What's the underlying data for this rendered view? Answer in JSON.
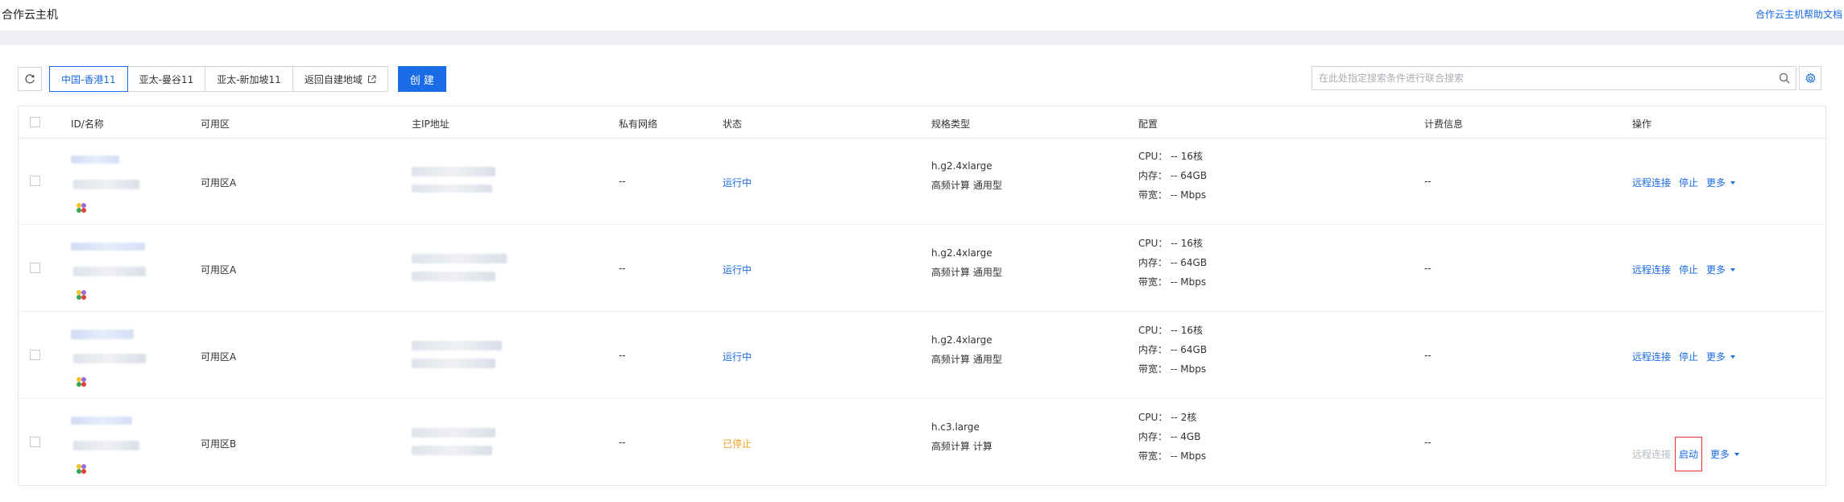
{
  "header": {
    "title": "合作云主机",
    "help_link": "合作云主机帮助文档"
  },
  "toolbar": {
    "regions": [
      {
        "label": "中国-香港11",
        "active": true
      },
      {
        "label": "亚太-曼谷11",
        "active": false
      },
      {
        "label": "亚太-新加坡11",
        "active": false
      },
      {
        "label": "返回自建地域",
        "active": false
      }
    ],
    "create_label": "创 建"
  },
  "search": {
    "placeholder": "在此处指定搜索条件进行联合搜索"
  },
  "table": {
    "columns": [
      "ID/名称",
      "可用区",
      "主IP地址",
      "私有网络",
      "状态",
      "规格类型",
      "配置",
      "计费信息",
      "操作"
    ],
    "rows": [
      {
        "zone": "可用区A",
        "vpc": "--",
        "status": "运行中",
        "status_type": "running",
        "spec_name": "h.g2.4xlarge",
        "spec_family": "高频计算 通用型",
        "cpu": "CPU：  -- 16核",
        "mem": "内存：  -- 64GB",
        "bw": "带宽：  -- Mbps",
        "billing": "--",
        "ops": {
          "remote": "远程连接",
          "action": "停止",
          "more": "更多"
        }
      },
      {
        "zone": "可用区A",
        "vpc": "--",
        "status": "运行中",
        "status_type": "running",
        "spec_name": "h.g2.4xlarge",
        "spec_family": "高频计算 通用型",
        "cpu": "CPU：  -- 16核",
        "mem": "内存：  -- 64GB",
        "bw": "带宽：  -- Mbps",
        "billing": "--",
        "ops": {
          "remote": "远程连接",
          "action": "停止",
          "more": "更多"
        }
      },
      {
        "zone": "可用区A",
        "vpc": "--",
        "status": "运行中",
        "status_type": "running",
        "spec_name": "h.g2.4xlarge",
        "spec_family": "高频计算 通用型",
        "cpu": "CPU：  -- 16核",
        "mem": "内存：  -- 64GB",
        "bw": "带宽：  -- Mbps",
        "billing": "--",
        "ops": {
          "remote": "远程连接",
          "action": "停止",
          "more": "更多"
        }
      },
      {
        "zone": "可用区B",
        "vpc": "--",
        "status": "已停止",
        "status_type": "stopped",
        "spec_name": "h.c3.large",
        "spec_family": "高频计算 计算",
        "cpu": "CPU：  -- 2核",
        "mem": "内存：  -- 4GB",
        "bw": "带宽：  -- Mbps",
        "billing": "--",
        "ops": {
          "remote": "远程连接",
          "action": "启动",
          "more": "更多"
        }
      }
    ]
  },
  "colors": {
    "accent": "#1a6be6",
    "running": "#1a6be6",
    "stopped": "#f0a020",
    "highlight_box": "#e0312f"
  }
}
